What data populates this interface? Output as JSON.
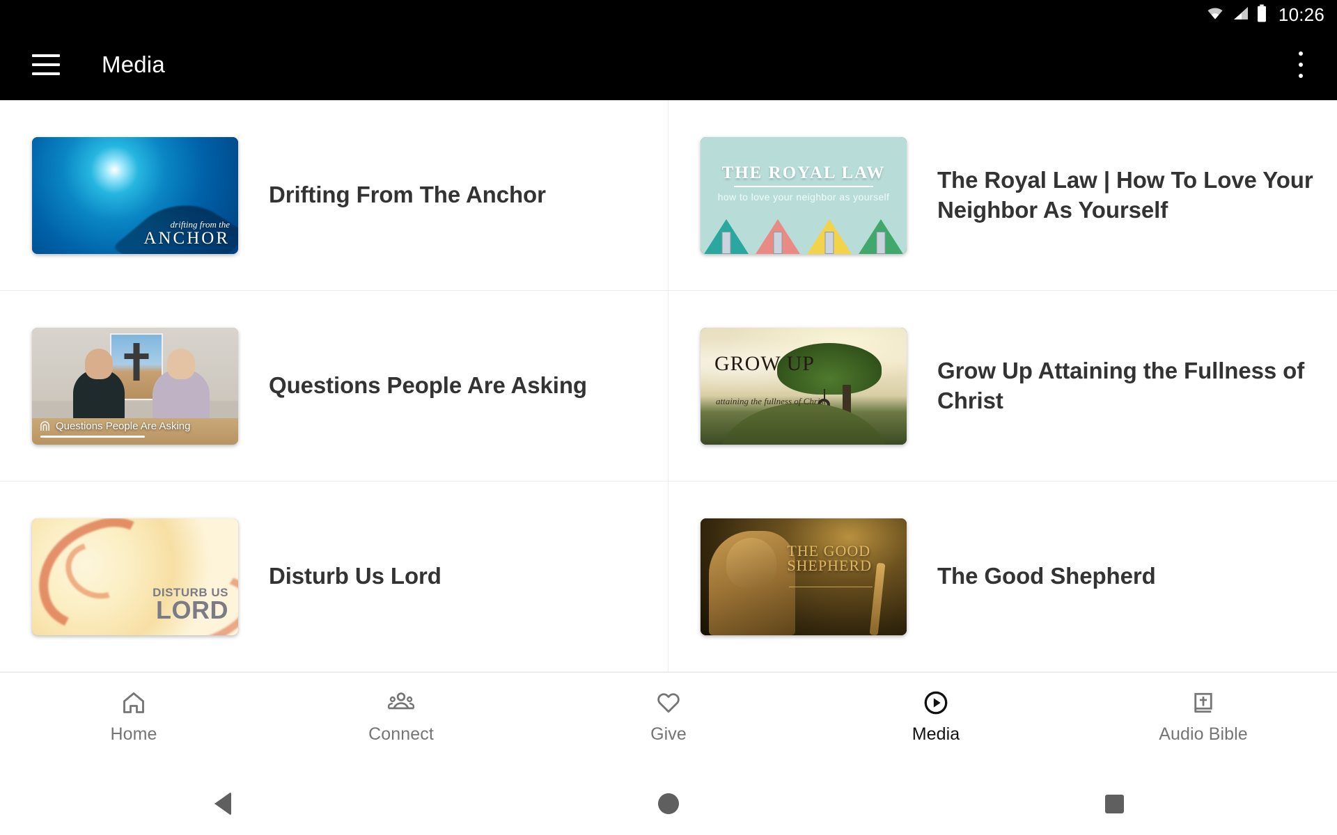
{
  "status_bar": {
    "time": "10:26",
    "icons": [
      "wifi-icon",
      "cellular-signal-icon",
      "battery-icon"
    ]
  },
  "app_bar": {
    "menu_icon": "hamburger-menu-icon",
    "title": "Media",
    "overflow_icon": "more-vertical-icon"
  },
  "media_items": [
    {
      "title": "Drifting From The Anchor",
      "thumb_overlay_line1": "drifting from the",
      "thumb_overlay_line2": "ANCHOR"
    },
    {
      "title": "The Royal Law | How To Love Your Neighbor As Yourself",
      "thumb_overlay_line1": "THE ROYAL LAW",
      "thumb_overlay_line2": "how to love your neighbor as yourself"
    },
    {
      "title": "Questions People Are Asking",
      "thumb_overlay_line1": "Questions People Are Asking",
      "thumb_overlay_line2": ""
    },
    {
      "title": "Grow Up Attaining the Fullness of Christ",
      "thumb_overlay_line1": "GROW UP",
      "thumb_overlay_line2": "attaining the fullness of Christ"
    },
    {
      "title": "Disturb Us Lord",
      "thumb_overlay_line1": "DISTURB US",
      "thumb_overlay_line2": "LORD"
    },
    {
      "title": "The Good Shepherd",
      "thumb_overlay_line1": "THE GOOD",
      "thumb_overlay_line2": "SHEPHERD"
    }
  ],
  "bottom_nav": {
    "items": [
      {
        "label": "Home",
        "icon": "home-icon",
        "active": false
      },
      {
        "label": "Connect",
        "icon": "people-group-icon",
        "active": false
      },
      {
        "label": "Give",
        "icon": "heart-outline-icon",
        "active": false
      },
      {
        "label": "Media",
        "icon": "play-circle-icon",
        "active": true
      },
      {
        "label": "Audio Bible",
        "icon": "bible-book-icon",
        "active": false
      }
    ]
  },
  "system_nav": {
    "back": "back-triangle-icon",
    "home": "home-circle-icon",
    "recents": "recents-square-icon"
  },
  "colors": {
    "app_bar_bg": "#000000",
    "page_bg": "#ffffff",
    "title_text": "#333333",
    "nav_inactive": "#757575",
    "nav_active": "#121212",
    "divider": "#ececec"
  },
  "roof_colors": [
    "#2aa8a0",
    "#e98a85",
    "#f2d34a",
    "#3fa86a"
  ]
}
